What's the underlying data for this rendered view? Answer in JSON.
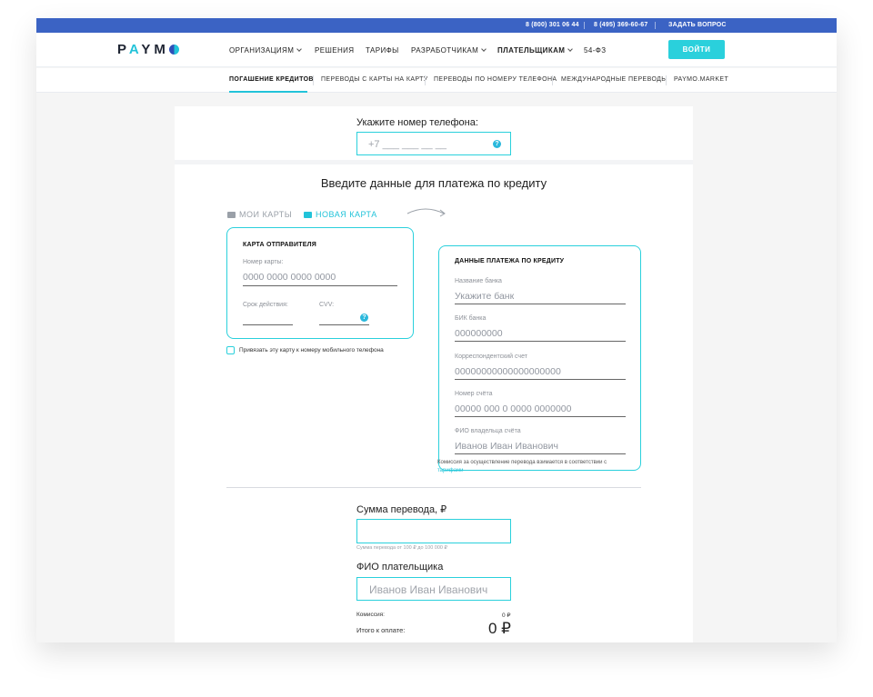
{
  "topbar": {
    "phone1": "8 (800) 301 06 44",
    "phone2": "8 (495) 369-60-67",
    "ask": "ЗАДАТЬ ВОПРОС",
    "color": "#3b63c4"
  },
  "header": {
    "logo": "PAYMO",
    "nav": [
      "ОРГАНИЗАЦИЯМ",
      "РЕШЕНИЯ",
      "ТАРИФЫ",
      "РАЗРАБОТЧИКАМ",
      "ПЛАТЕЛЬЩИКАМ",
      "54-ФЗ"
    ],
    "login": "ВОЙТИ",
    "accent": "#2ad0dc"
  },
  "subnav": {
    "items": [
      "ПОГАШЕНИЕ КРЕДИТОВ",
      "ПЕРЕВОДЫ С КАРТЫ НА КАРТУ",
      "ПЕРЕВОДЫ ПО НОМЕРУ ТЕЛЕФОНА",
      "МЕЖДУНАРОДНЫЕ ПЕРЕВОДЫ",
      "PAYMO.MARKET"
    ],
    "active": "ПОГАШЕНИЕ КРЕДИТОВ"
  },
  "phone": {
    "label": "Укажите номер телефона:",
    "placeholder": "+7 ___ ___ __ __"
  },
  "form": {
    "title": "Введите данные для платежа по кредиту",
    "tab_mine": "МОИ КАРТЫ",
    "tab_new": "НОВАЯ КАРТА"
  },
  "sender": {
    "title": "КАРТА ОТПРАВИТЕЛЯ",
    "card_number_label": "Номер карты:",
    "card_number_placeholder": "0000 0000 0000 0000",
    "expiry_label": "Срок действия:",
    "cvv_label": "CVV:",
    "bind_label": "Привязать эту карту к номеру мобильного телефона"
  },
  "credit": {
    "title": "ДАННЫЕ ПЛАТЕЖА ПО КРЕДИТУ",
    "fields": [
      {
        "label": "Название банка",
        "placeholder": "Укажите банк"
      },
      {
        "label": "БИК банка",
        "placeholder": "000000000"
      },
      {
        "label": "Корреспондентский счет",
        "placeholder": "00000000000000000000"
      },
      {
        "label": "Номер счёта",
        "placeholder": "00000 000 0 0000 0000000"
      },
      {
        "label": "ФИО владельца счёта",
        "placeholder": "Иванов Иван Иванович"
      }
    ],
    "note": "Комиссия за осуществление перевода взимается в соответствии с",
    "note_link": "тарифами"
  },
  "amount": {
    "label": "Сумма перевода, ₽",
    "hint": "Сумма перевода от 100 ₽ до 100 000 ₽"
  },
  "payer": {
    "label": "ФИО плательщика",
    "placeholder": "Иванов Иван Иванович"
  },
  "summary": {
    "commission_label": "Комиссия:",
    "commission_value": "0 ₽",
    "total_label": "Итого к оплате:",
    "total_value": "0 ₽"
  }
}
